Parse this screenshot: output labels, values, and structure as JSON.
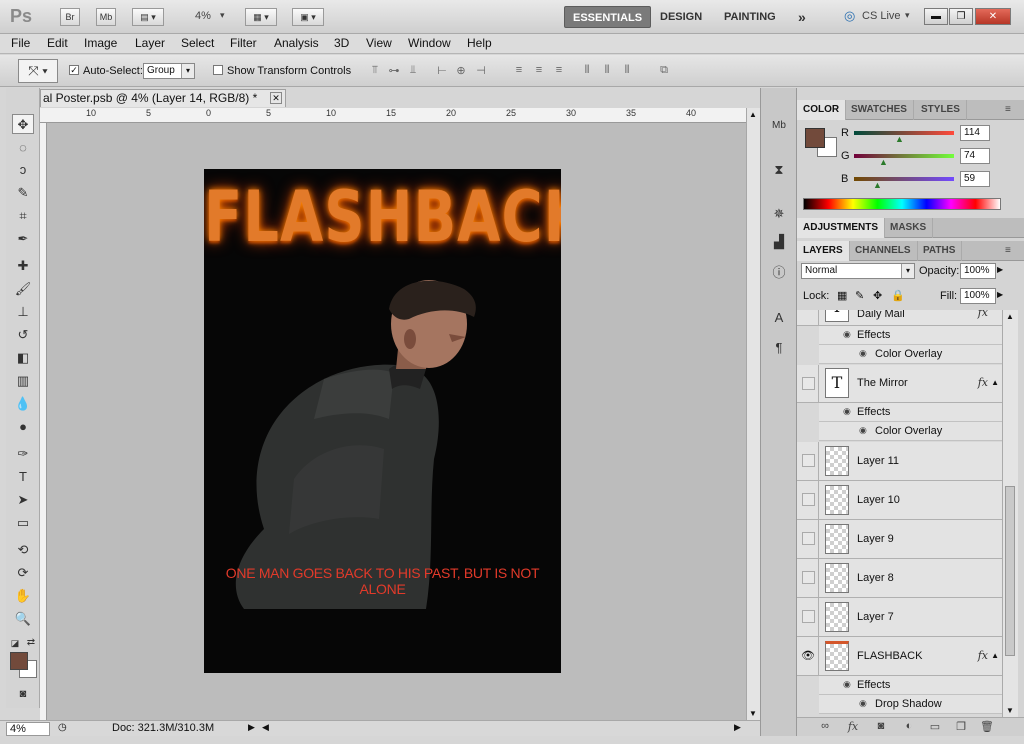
{
  "appbar": {
    "logo": "Ps",
    "br_label": "Br",
    "mb_label": "Mb",
    "zoom": "4%",
    "workspaces": [
      "ESSENTIALS",
      "DESIGN",
      "PAINTING"
    ],
    "more": "»",
    "cslive": "CS Live"
  },
  "menu": [
    "File",
    "Edit",
    "Image",
    "Layer",
    "Select",
    "Filter",
    "Analysis",
    "3D",
    "View",
    "Window",
    "Help"
  ],
  "options": {
    "auto_select_label": "Auto-Select:",
    "auto_select_checked": "✓",
    "auto_select_value": "Group",
    "show_transform_label": "Show Transform Controls"
  },
  "document": {
    "tab_title": "al Poster.psb @ 4% (Layer 14, RGB/8) *",
    "ruler_x": [
      "10",
      "5",
      "0",
      "5",
      "10",
      "15",
      "20",
      "25",
      "30",
      "35",
      "40"
    ],
    "poster_title": "FLASHBACK",
    "poster_tagline": "ONE MAN GOES BACK TO HIS PAST, BUT IS NOT ALONE"
  },
  "status": {
    "zoom": "4%",
    "doc_info": "Doc: 321.3M/310.3M"
  },
  "color_panel": {
    "tabs": [
      "COLOR",
      "SWATCHES",
      "STYLES"
    ],
    "r_label": "R",
    "g_label": "G",
    "b_label": "B",
    "r_value": "114",
    "g_value": "74",
    "b_value": "59",
    "foreground": "#724a3b"
  },
  "adjustments_panel": {
    "tabs": [
      "ADJUSTMENTS",
      "MASKS"
    ]
  },
  "layers_panel": {
    "tabs": [
      "LAYERS",
      "CHANNELS",
      "PATHS"
    ],
    "blend_mode": "Normal",
    "opacity_label": "Opacity:",
    "opacity_value": "100%",
    "lock_label": "Lock:",
    "fill_label": "Fill:",
    "fill_value": "100%",
    "partial_top_name": "Daily Mail",
    "effects_label": "Effects",
    "color_overlay_label": "Color Overlay",
    "drop_shadow_label": "Drop Shadow",
    "mirror_name": "The Mirror",
    "layers": [
      "Layer 11",
      "Layer 10",
      "Layer 9",
      "Layer 8",
      "Layer 7"
    ],
    "flashback_name": "FLASHBACK",
    "fx_label": "fx",
    "text_thumb": "T"
  }
}
